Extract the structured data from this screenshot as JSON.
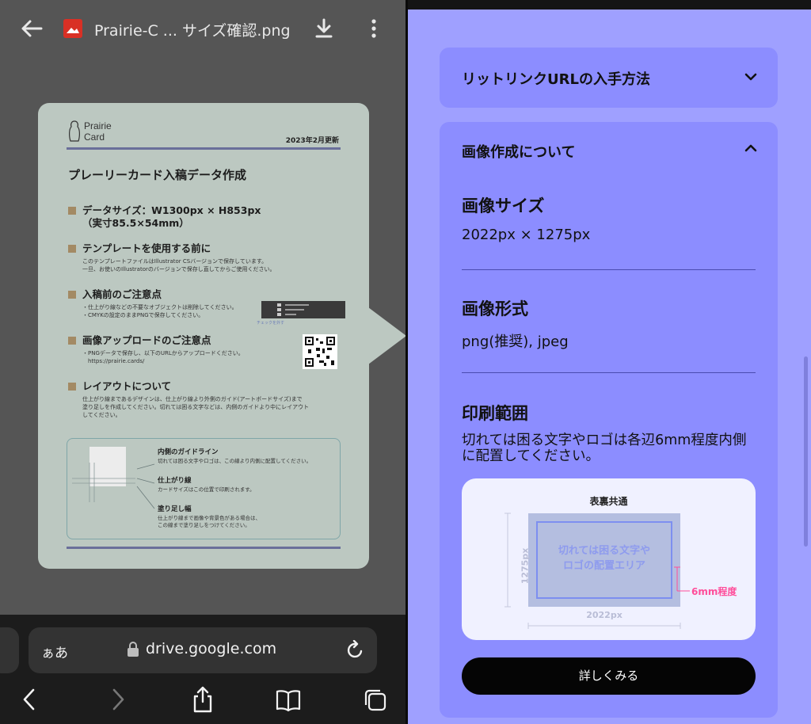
{
  "viewer": {
    "file_name": "Prairie-C ... サイズ確認.png",
    "icons": {
      "back": "arrow-left-icon",
      "file": "image-file-icon",
      "download": "download-icon",
      "more": "more-vertical-icon"
    }
  },
  "image_card": {
    "logo_lines": [
      "Prairie",
      "Card"
    ],
    "update_date": "2023年2月更新",
    "title": "プレーリーカード入稿データ作成",
    "sections": [
      {
        "head": "データサイズ：W1300px × H853px\n（実寸85.5×54mm）",
        "body": ""
      },
      {
        "head": "テンプレートを使用する前に",
        "body": "このテンプレートファイルはIllustrator CSバージョンで保存しています。\n一旦、お使いのIllustratorのバージョンで保存し直してからご使用ください。"
      },
      {
        "head": "入稿前のご注意点",
        "body": "・仕上がり線などの不要なオブジェクトは削除してください。\n・CMYKの設定のままPNGで保存してください。"
      },
      {
        "head": "画像アップロードのご注意点",
        "body": "・PNGデータで保存し、以下のURLからアップロードください。\n　https://prairie.cards/"
      },
      {
        "head": "レイアウトについて",
        "body": "仕上がり線まであるデザインは、仕上がり線より外側のガイド(アートボードサイズ)まで\n塗り足しを作成してください。切れては困る文字などは、内側のガイドより中にレイアウト\nしてください。"
      }
    ],
    "layer_note": "チェックを外す",
    "guides": [
      {
        "head": "内側のガイドライン",
        "body": "切れては困る文字やロゴは、この線より内側に配置してください。"
      },
      {
        "head": "仕上がり線",
        "body": "カードサイズはこの位置で印刷されます。"
      },
      {
        "head": "塗り足し幅",
        "body": "仕上がり線まで画像や背景色がある場合は、\nこの線まで塗り足しをつけてください。"
      }
    ]
  },
  "browser": {
    "aa_label": "ぁあ",
    "url": "drive.google.com",
    "icons": {
      "lock": "lock-icon",
      "reload": "reload-icon",
      "back": "chevron-left-icon",
      "forward": "chevron-right-icon",
      "share": "share-icon",
      "bookmarks": "book-icon",
      "tabs": "tabs-icon"
    }
  },
  "faq": {
    "accordion1": {
      "title": "リットリンクURLの入手方法",
      "state": "collapsed",
      "icon": "chevron-down-icon"
    },
    "accordion2": {
      "title": "画像作成について",
      "state": "expanded",
      "icon": "chevron-up-icon",
      "size_head": "画像サイズ",
      "size_value": "2022px × 1275px",
      "format_head": "画像形式",
      "format_value": "png(推奨), jpeg",
      "print_head": "印刷範囲",
      "print_desc": "切れては困る文字やロゴは各辺6mm程度内側に配置してください。",
      "diagram": {
        "title": "表裏共通",
        "area_label": "切れては困る文字や\nロゴの配置エリア",
        "height_label": "1275px",
        "width_label": "2022px",
        "margin_label": "6mm程度"
      },
      "cta_label": "詳しくみる"
    }
  },
  "colors": {
    "right_bg": "#9fa0ff",
    "accordion_bg": "#8c8dff",
    "card_bg": "#bcc8c1",
    "accent_pink": "#ff4d9a",
    "cta_bg": "#050505"
  }
}
